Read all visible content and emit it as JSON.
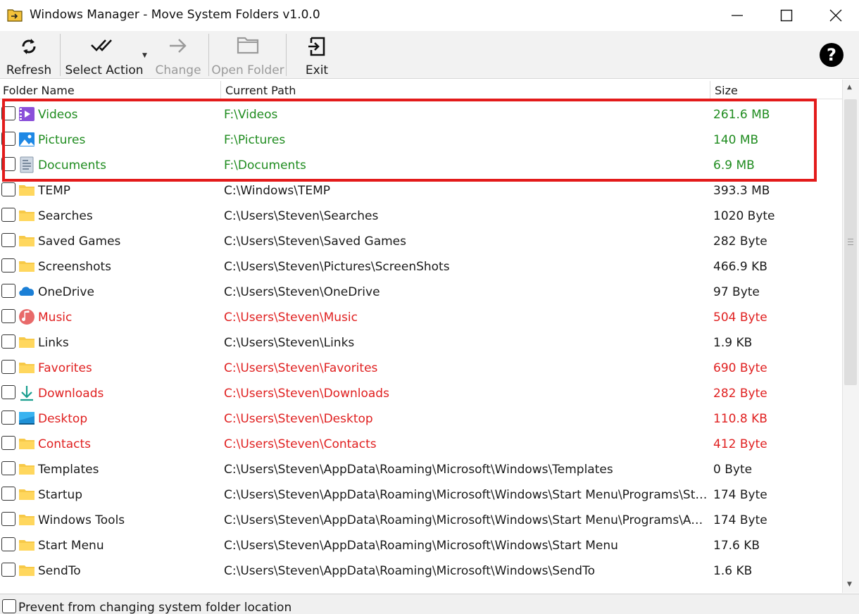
{
  "window": {
    "title": "Windows Manager - Move System Folders v1.0.0",
    "app_icon": "folder-arrow-icon"
  },
  "toolbar": {
    "refresh_label": "Refresh",
    "select_action_label": "Select Action",
    "change_label": "Change",
    "open_folder_label": "Open Folder",
    "exit_label": "Exit"
  },
  "columns": {
    "folder_name": "Folder Name",
    "current_path": "Current Path",
    "size": "Size"
  },
  "rows": [
    {
      "name": "Videos",
      "path": "F:\\Videos",
      "size": "261.6 MB",
      "status": "green",
      "icon": "videos-icon"
    },
    {
      "name": "Pictures",
      "path": "F:\\Pictures",
      "size": "140 MB",
      "status": "green",
      "icon": "pictures-icon"
    },
    {
      "name": "Documents",
      "path": "F:\\Documents",
      "size": "6.9 MB",
      "status": "green",
      "icon": "documents-icon"
    },
    {
      "name": "TEMP",
      "path": "C:\\Windows\\TEMP",
      "size": "393.3 MB",
      "status": "normal",
      "icon": "folder-icon"
    },
    {
      "name": "Searches",
      "path": "C:\\Users\\Steven\\Searches",
      "size": "1020 Byte",
      "status": "normal",
      "icon": "folder-icon"
    },
    {
      "name": "Saved Games",
      "path": "C:\\Users\\Steven\\Saved Games",
      "size": "282 Byte",
      "status": "normal",
      "icon": "folder-icon"
    },
    {
      "name": "Screenshots",
      "path": "C:\\Users\\Steven\\Pictures\\ScreenShots",
      "size": "466.9 KB",
      "status": "normal",
      "icon": "folder-icon"
    },
    {
      "name": "OneDrive",
      "path": "C:\\Users\\Steven\\OneDrive",
      "size": "97 Byte",
      "status": "normal",
      "icon": "onedrive-icon"
    },
    {
      "name": "Music",
      "path": "C:\\Users\\Steven\\Music",
      "size": "504 Byte",
      "status": "red",
      "icon": "music-icon"
    },
    {
      "name": "Links",
      "path": "C:\\Users\\Steven\\Links",
      "size": "1.9 KB",
      "status": "normal",
      "icon": "folder-icon"
    },
    {
      "name": "Favorites",
      "path": "C:\\Users\\Steven\\Favorites",
      "size": "690 Byte",
      "status": "red",
      "icon": "folder-icon"
    },
    {
      "name": "Downloads",
      "path": "C:\\Users\\Steven\\Downloads",
      "size": "282 Byte",
      "status": "red",
      "icon": "downloads-icon"
    },
    {
      "name": "Desktop",
      "path": "C:\\Users\\Steven\\Desktop",
      "size": "110.8 KB",
      "status": "red",
      "icon": "desktop-icon"
    },
    {
      "name": "Contacts",
      "path": "C:\\Users\\Steven\\Contacts",
      "size": "412 Byte",
      "status": "red",
      "icon": "folder-icon"
    },
    {
      "name": "Templates",
      "path": "C:\\Users\\Steven\\AppData\\Roaming\\Microsoft\\Windows\\Templates",
      "size": "0 Byte",
      "status": "normal",
      "icon": "folder-icon"
    },
    {
      "name": "Startup",
      "path": "C:\\Users\\Steven\\AppData\\Roaming\\Microsoft\\Windows\\Start Menu\\Programs\\Startup",
      "size": "174 Byte",
      "status": "normal",
      "icon": "folder-icon"
    },
    {
      "name": "Windows Tools",
      "path": "C:\\Users\\Steven\\AppData\\Roaming\\Microsoft\\Windows\\Start Menu\\Programs\\Admi...",
      "size": "174 Byte",
      "status": "normal",
      "icon": "folder-icon"
    },
    {
      "name": "Start Menu",
      "path": "C:\\Users\\Steven\\AppData\\Roaming\\Microsoft\\Windows\\Start Menu",
      "size": "17.6 KB",
      "status": "normal",
      "icon": "folder-icon"
    },
    {
      "name": "SendTo",
      "path": "C:\\Users\\Steven\\AppData\\Roaming\\Microsoft\\Windows\\SendTo",
      "size": "1.6 KB",
      "status": "normal",
      "icon": "folder-icon"
    }
  ],
  "statusbar": {
    "prevent_label": "Prevent from changing system folder location"
  },
  "colors": {
    "moved_green": "#1f8c1f",
    "warning_red": "#e02020",
    "highlight_red": "#e31b1b",
    "folder_yellow": "#f7c948"
  }
}
